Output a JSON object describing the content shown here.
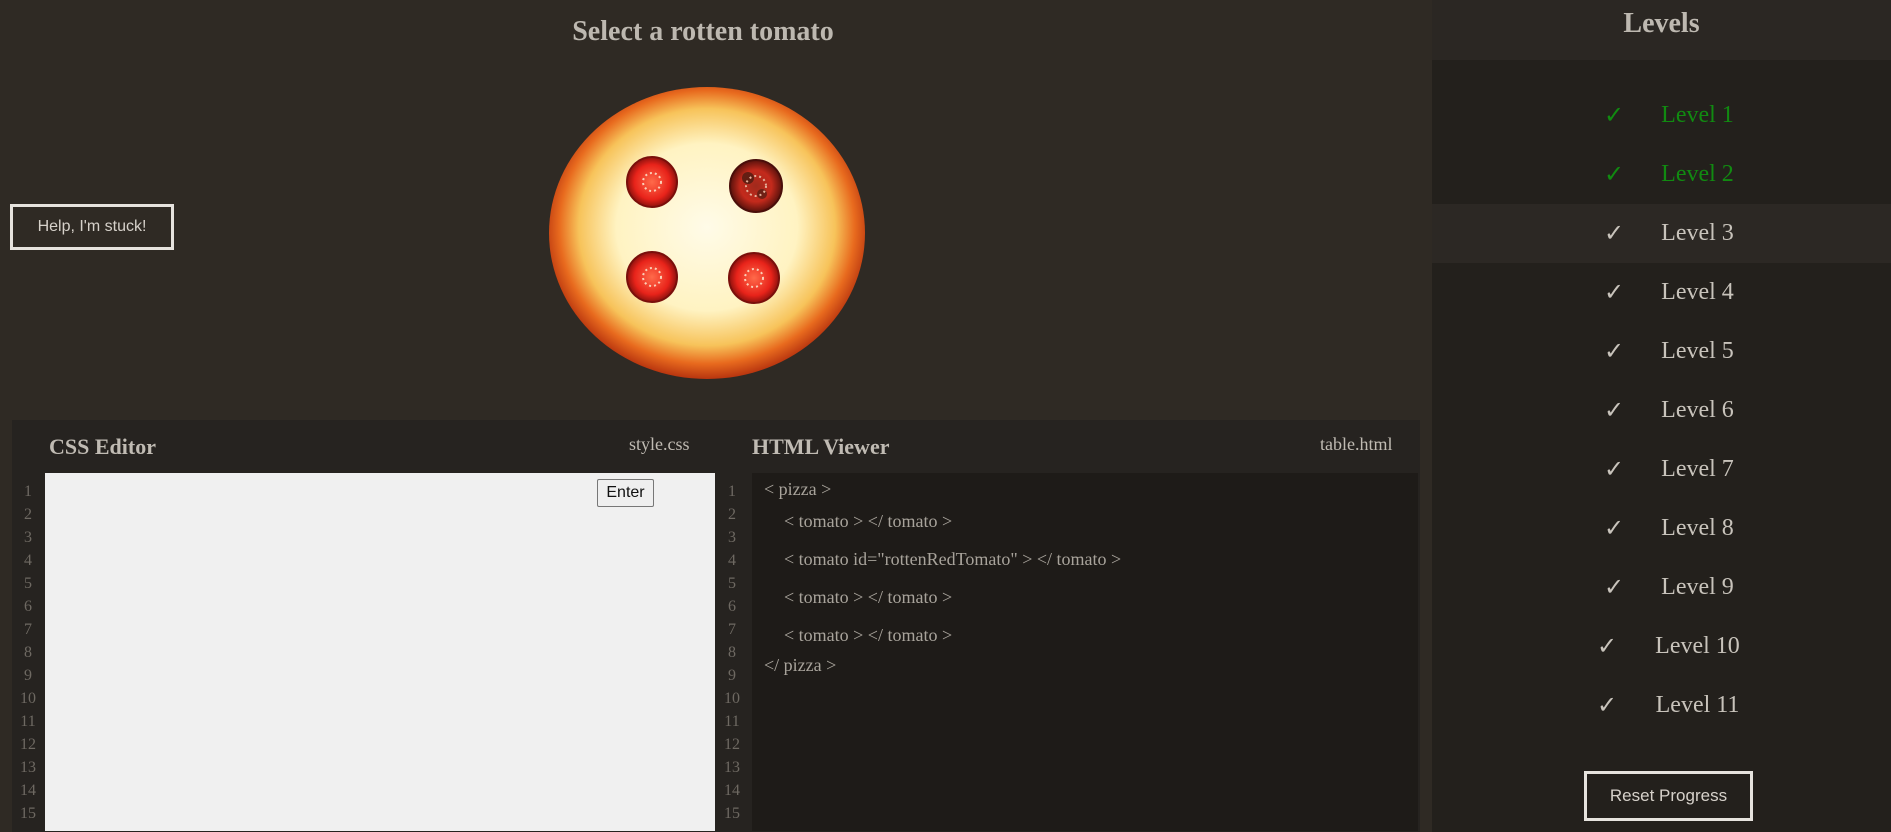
{
  "game": {
    "instruction": "Select a rotten tomato",
    "help_button": "Help, I'm stuck!"
  },
  "css_editor": {
    "title": "CSS Editor",
    "filename": "style.css",
    "enter_button": "Enter",
    "line_numbers": [
      "1",
      "2",
      "3",
      "4",
      "5",
      "6",
      "7",
      "8",
      "9",
      "10",
      "11",
      "12",
      "13",
      "14",
      "15"
    ],
    "input_value": ""
  },
  "html_viewer": {
    "title": "HTML Viewer",
    "filename": "table.html",
    "line_numbers": [
      "1",
      "2",
      "3",
      "4",
      "5",
      "6",
      "7",
      "8",
      "9",
      "10",
      "11",
      "12",
      "13",
      "14",
      "15"
    ],
    "code": [
      "< pizza >",
      "< tomato > </ tomato >",
      "< tomato id=\"rottenRedTomato\" > </ tomato >",
      "< tomato > </ tomato >",
      "< tomato > </ tomato >",
      "</ pizza >"
    ]
  },
  "sidebar": {
    "title": "Levels",
    "check_glyph": "✓",
    "levels": [
      {
        "label": "Level 1",
        "state": "completed"
      },
      {
        "label": "Level 2",
        "state": "completed"
      },
      {
        "label": "Level 3",
        "state": "current"
      },
      {
        "label": "Level 4",
        "state": "locked"
      },
      {
        "label": "Level 5",
        "state": "locked"
      },
      {
        "label": "Level 6",
        "state": "locked"
      },
      {
        "label": "Level 7",
        "state": "locked"
      },
      {
        "label": "Level 8",
        "state": "locked"
      },
      {
        "label": "Level 9",
        "state": "locked"
      },
      {
        "label": "Level 10",
        "state": "locked"
      },
      {
        "label": "Level 11",
        "state": "locked"
      }
    ],
    "reset_button": "Reset Progress"
  },
  "colors": {
    "background": "#2f2a24",
    "completed_level": "#118a11",
    "editor_bg": "#f0f0f0",
    "code_bg": "#1e1b18"
  }
}
